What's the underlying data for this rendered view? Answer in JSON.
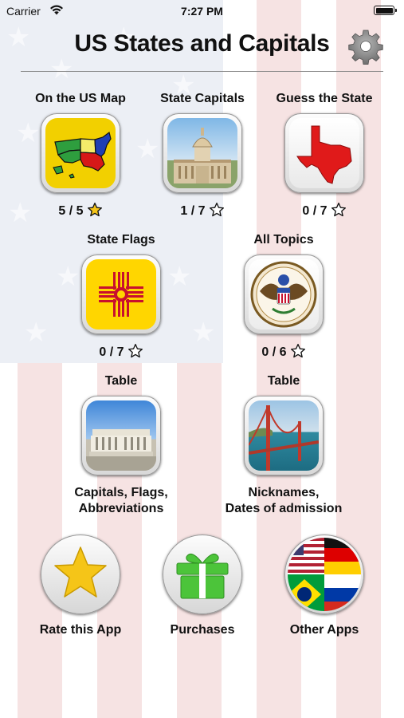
{
  "status_bar": {
    "carrier": "Carrier",
    "time": "7:27 PM"
  },
  "header": {
    "title": "US States and Capitals"
  },
  "quizzes": [
    {
      "label": "On the US Map",
      "score": "5 / 5",
      "completed": true
    },
    {
      "label": "State Capitals",
      "score": "1 / 7",
      "completed": false
    },
    {
      "label": "Guess the State",
      "score": "0 / 7",
      "completed": false
    },
    {
      "label": "State Flags",
      "score": "0 / 7",
      "completed": false
    },
    {
      "label": "All Topics",
      "score": "0 / 6",
      "completed": false
    }
  ],
  "tables": [
    {
      "label": "Table",
      "caption_line1": "Capitals, Flags,",
      "caption_line2": "Abbreviations"
    },
    {
      "label": "Table",
      "caption_line1": "Nicknames,",
      "caption_line2": "Dates of admission"
    }
  ],
  "bottom_actions": [
    {
      "label": "Rate this App",
      "icon": "star-icon"
    },
    {
      "label": "Purchases",
      "icon": "gift-icon"
    },
    {
      "label": "Other Apps",
      "icon": "world-flags-icon"
    }
  ],
  "colors": {
    "star_gold": "#f5c518",
    "tx_red": "#e01a1a",
    "gift_green": "#4cc43a"
  }
}
